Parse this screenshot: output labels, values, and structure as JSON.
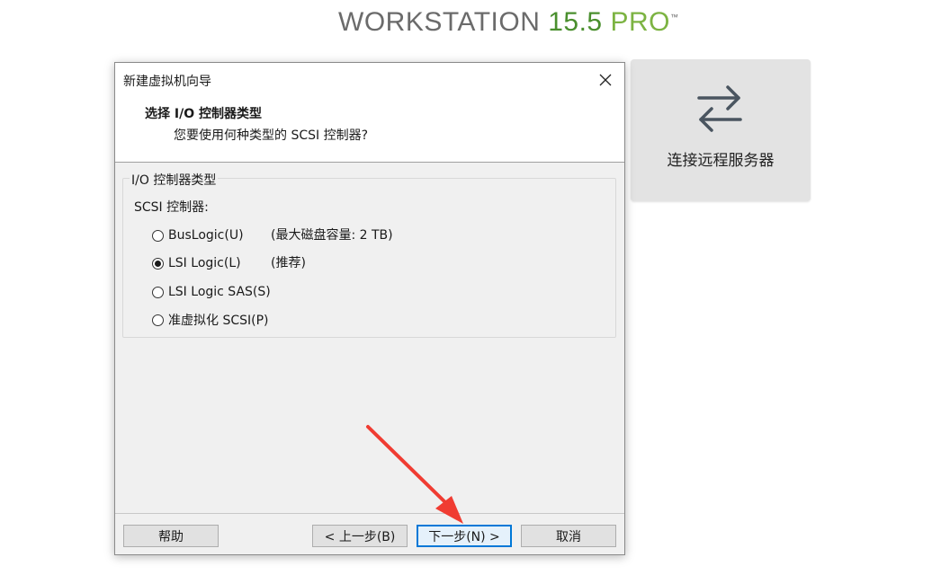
{
  "brand": {
    "part1": "WORKSTATION ",
    "part2": "15.5",
    "part3": " PRO",
    "tm": "™"
  },
  "remote_tile": {
    "label": "连接远程服务器",
    "icon": "swap-arrows-icon"
  },
  "dialog": {
    "title": "新建虚拟机向导",
    "header_title": "选择 I/O 控制器类型",
    "header_subtitle": "您要使用何种类型的 SCSI 控制器?",
    "group_label": "I/O 控制器类型",
    "scsi_label": "SCSI 控制器:",
    "options": [
      {
        "label": "BusLogic(U)",
        "note": "(最大磁盘容量: 2 TB)",
        "checked": false
      },
      {
        "label": "LSI Logic(L)",
        "note": "(推荐)",
        "checked": true
      },
      {
        "label": "LSI Logic SAS(S)",
        "note": "",
        "checked": false
      },
      {
        "label": "准虚拟化 SCSI(P)",
        "note": "",
        "checked": false
      }
    ],
    "buttons": {
      "help": "帮助",
      "back": "< 上一步(B)",
      "next": "下一步(N) >",
      "cancel": "取消"
    }
  },
  "colors": {
    "accent": "#0078d7",
    "annotation_arrow": "#f03c32",
    "brand_green": "#4a8f2e"
  }
}
